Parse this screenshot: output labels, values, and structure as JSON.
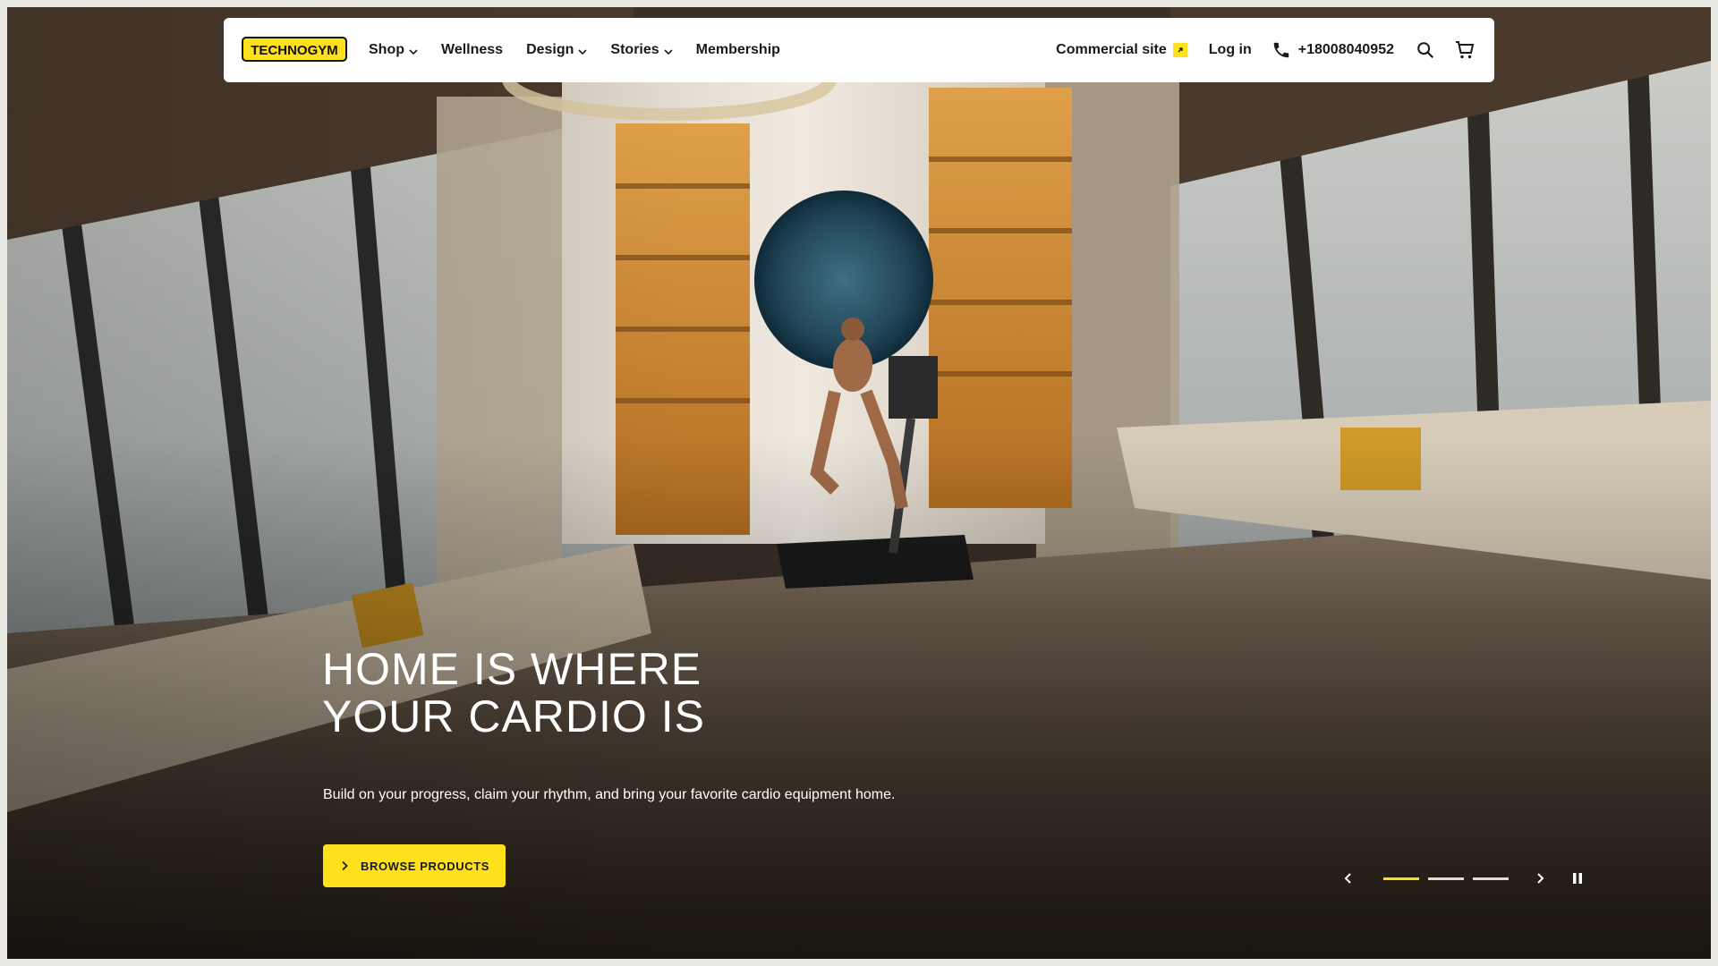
{
  "header": {
    "logo_text": "TECHNOGYM",
    "nav": [
      {
        "label": "Shop",
        "has_dropdown": true
      },
      {
        "label": "Wellness",
        "has_dropdown": false
      },
      {
        "label": "Design",
        "has_dropdown": true
      },
      {
        "label": "Stories",
        "has_dropdown": true
      },
      {
        "label": "Membership",
        "has_dropdown": false
      }
    ],
    "commercial_site": "Commercial site",
    "login": "Log in",
    "phone": "+18008040952",
    "icons": [
      "phone-icon",
      "search-icon",
      "cart-icon",
      "external-link-icon",
      "chevron-down-icon"
    ]
  },
  "hero": {
    "headline": "HOME IS WHERE YOUR CARDIO IS",
    "subtext": "Build on your progress, claim your rhythm, and bring your favorite cardio equipment home.",
    "cta_label": "BROWSE PRODUCTS"
  },
  "carousel": {
    "slides": 3,
    "active_index": 0,
    "icons": [
      "chevron-left-icon",
      "chevron-right-icon",
      "pause-icon"
    ]
  },
  "colors": {
    "accent": "#ffe11b",
    "text_dark": "#1a1a1a",
    "header_bg": "#ffffff"
  }
}
